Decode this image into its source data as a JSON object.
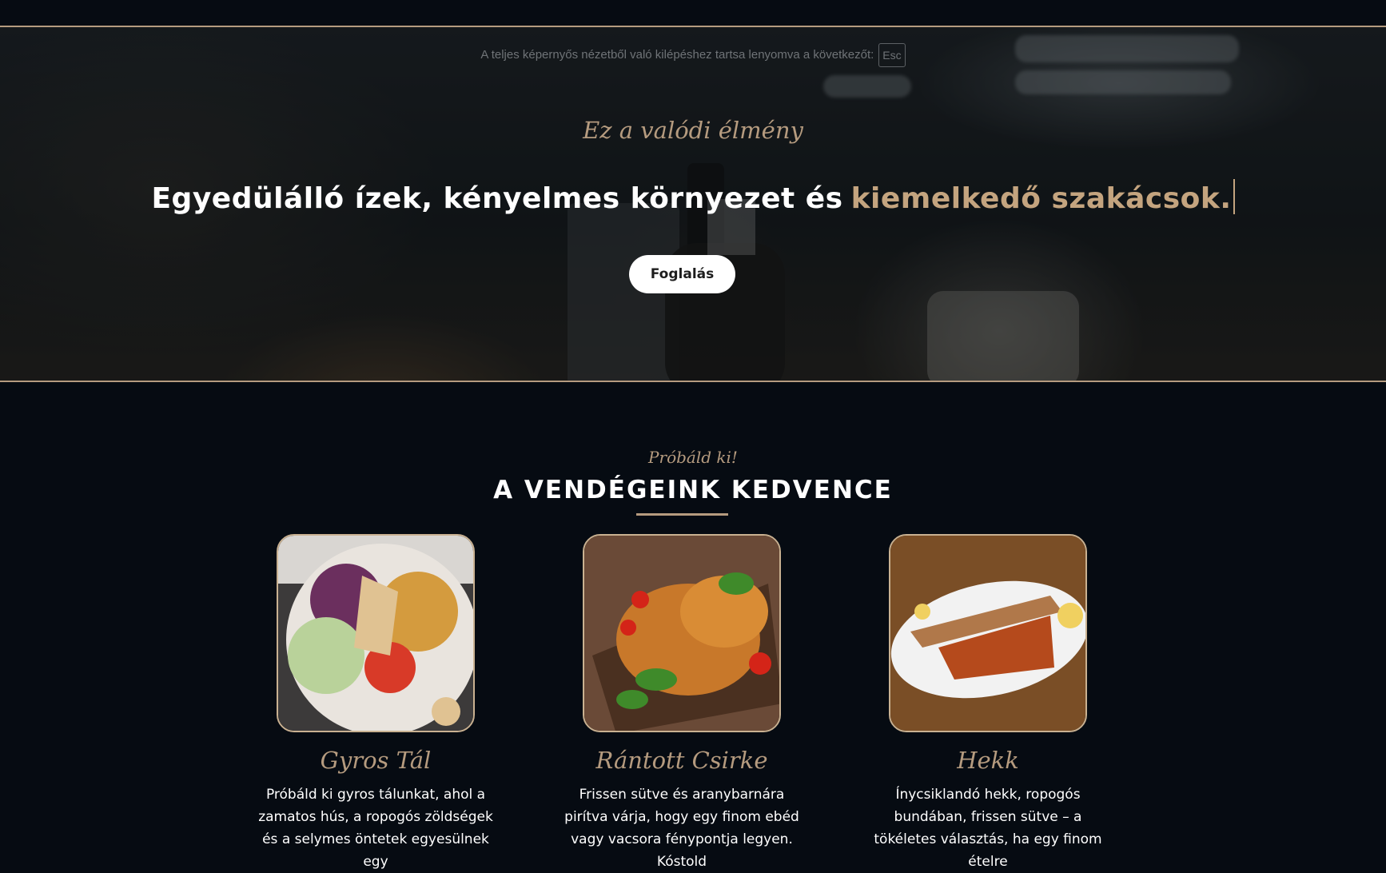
{
  "fullscreen_hint": {
    "text": "A teljes képernyős nézetből való kilépéshez tartsa lenyomva a következőt:",
    "key": "Esc"
  },
  "hero": {
    "subtitle": "Ez a valódi élmény",
    "title_main": "Egyedülálló ízek, kényelmes környezet és",
    "title_accent": "kiemelkedő szakácsok.",
    "button_label": "Foglalás"
  },
  "favorites": {
    "kicker": "Próbáld ki!",
    "title": "A VENDÉGEINK KEDVENCE",
    "dishes": [
      {
        "name": "Gyros Tál",
        "description": "Próbáld ki gyros tálunkat, ahol a zamatos hús, a ropogós zöldségek és a selymes öntetek egyesülnek egy",
        "image": "gyros-plate-photo"
      },
      {
        "name": "Rántott Csirke",
        "description": "Frissen sütve és aranybarnára pirítva várja, hogy egy finom ebéd vagy vacsora fénypontja legyen. Kóstold",
        "image": "fried-chicken-photo"
      },
      {
        "name": "Hekk",
        "description": "Ínycsiklandó hekk, ropogós bundában, frissen sütve – a tökéletes választás, ha egy finom ételre",
        "image": "fried-hake-photo"
      }
    ]
  },
  "colors": {
    "background": "#060b12",
    "accent": "#b59b7f",
    "button_bg": "#ffffff"
  }
}
